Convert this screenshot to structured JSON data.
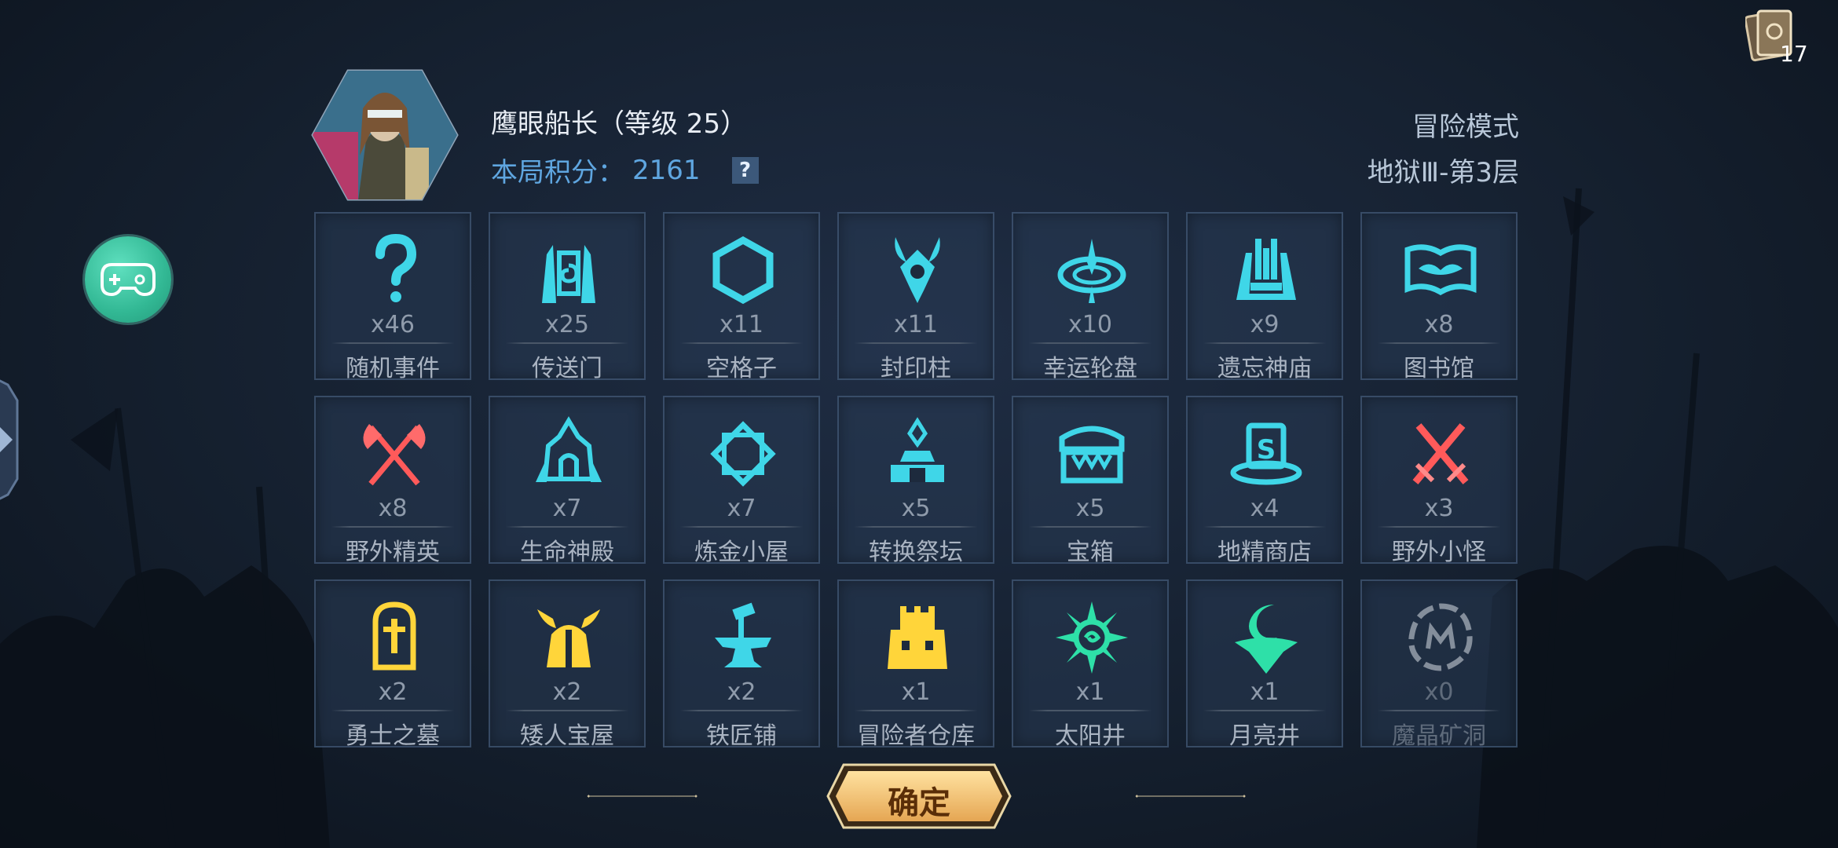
{
  "deck": {
    "count": "17"
  },
  "player": {
    "name": "鹰眼船长（等级 25）",
    "score_label": "本局积分：",
    "score_value": "2161",
    "help_label": "?"
  },
  "run": {
    "mode": "冒险模式",
    "floor": "地狱Ⅲ-第3层"
  },
  "tiles": [
    {
      "icon": "question-mark-icon",
      "count": "x46",
      "label": "随机事件",
      "color": "#3fd6e8"
    },
    {
      "icon": "portal-gate-icon",
      "count": "x25",
      "label": "传送门",
      "color": "#3fd6e8"
    },
    {
      "icon": "hexagon-icon",
      "count": "x11",
      "label": "空格子",
      "color": "#3fd6e8"
    },
    {
      "icon": "seal-pillar-icon",
      "count": "x11",
      "label": "封印柱",
      "color": "#3fd6e8"
    },
    {
      "icon": "lucky-wheel-icon",
      "count": "x10",
      "label": "幸运轮盘",
      "color": "#3fd6e8"
    },
    {
      "icon": "temple-pillars-icon",
      "count": "x9",
      "label": "遗忘神庙",
      "color": "#3fd6e8"
    },
    {
      "icon": "open-book-icon",
      "count": "x8",
      "label": "图书馆",
      "color": "#3fd6e8"
    },
    {
      "icon": "crossed-axes-icon",
      "count": "x8",
      "label": "野外精英",
      "color": "#ff5a5a"
    },
    {
      "icon": "life-shrine-icon",
      "count": "x7",
      "label": "生命神殿",
      "color": "#3fd6e8"
    },
    {
      "icon": "alchemy-frame-icon",
      "count": "x7",
      "label": "炼金小屋",
      "color": "#3fd6e8"
    },
    {
      "icon": "altar-icon",
      "count": "x5",
      "label": "转换祭坛",
      "color": "#3fd6e8"
    },
    {
      "icon": "treasure-chest-icon",
      "count": "x5",
      "label": "宝箱",
      "color": "#3fd6e8"
    },
    {
      "icon": "goblin-shop-hat-icon",
      "count": "x4",
      "label": "地精商店",
      "color": "#3fd6e8"
    },
    {
      "icon": "crossed-swords-icon",
      "count": "x3",
      "label": "野外小怪",
      "color": "#ff5a5a"
    },
    {
      "icon": "tombstone-icon",
      "count": "x2",
      "label": "勇士之墓",
      "color": "#ffd53a"
    },
    {
      "icon": "dwarf-helmet-icon",
      "count": "x2",
      "label": "矮人宝屋",
      "color": "#ffd53a"
    },
    {
      "icon": "anvil-hammer-icon",
      "count": "x2",
      "label": "铁匠铺",
      "color": "#3fd6e8"
    },
    {
      "icon": "warehouse-tower-icon",
      "count": "x1",
      "label": "冒险者仓库",
      "color": "#ffd53a"
    },
    {
      "icon": "sun-well-icon",
      "count": "x1",
      "label": "太阳井",
      "color": "#2ee0a8"
    },
    {
      "icon": "moon-well-icon",
      "count": "x1",
      "label": "月亮井",
      "color": "#2ee0a8"
    },
    {
      "icon": "crystal-mine-icon",
      "count": "x0",
      "label": "魔晶矿洞",
      "color": "#d8dde4",
      "dim": true
    }
  ],
  "confirm": {
    "label": "确定"
  }
}
